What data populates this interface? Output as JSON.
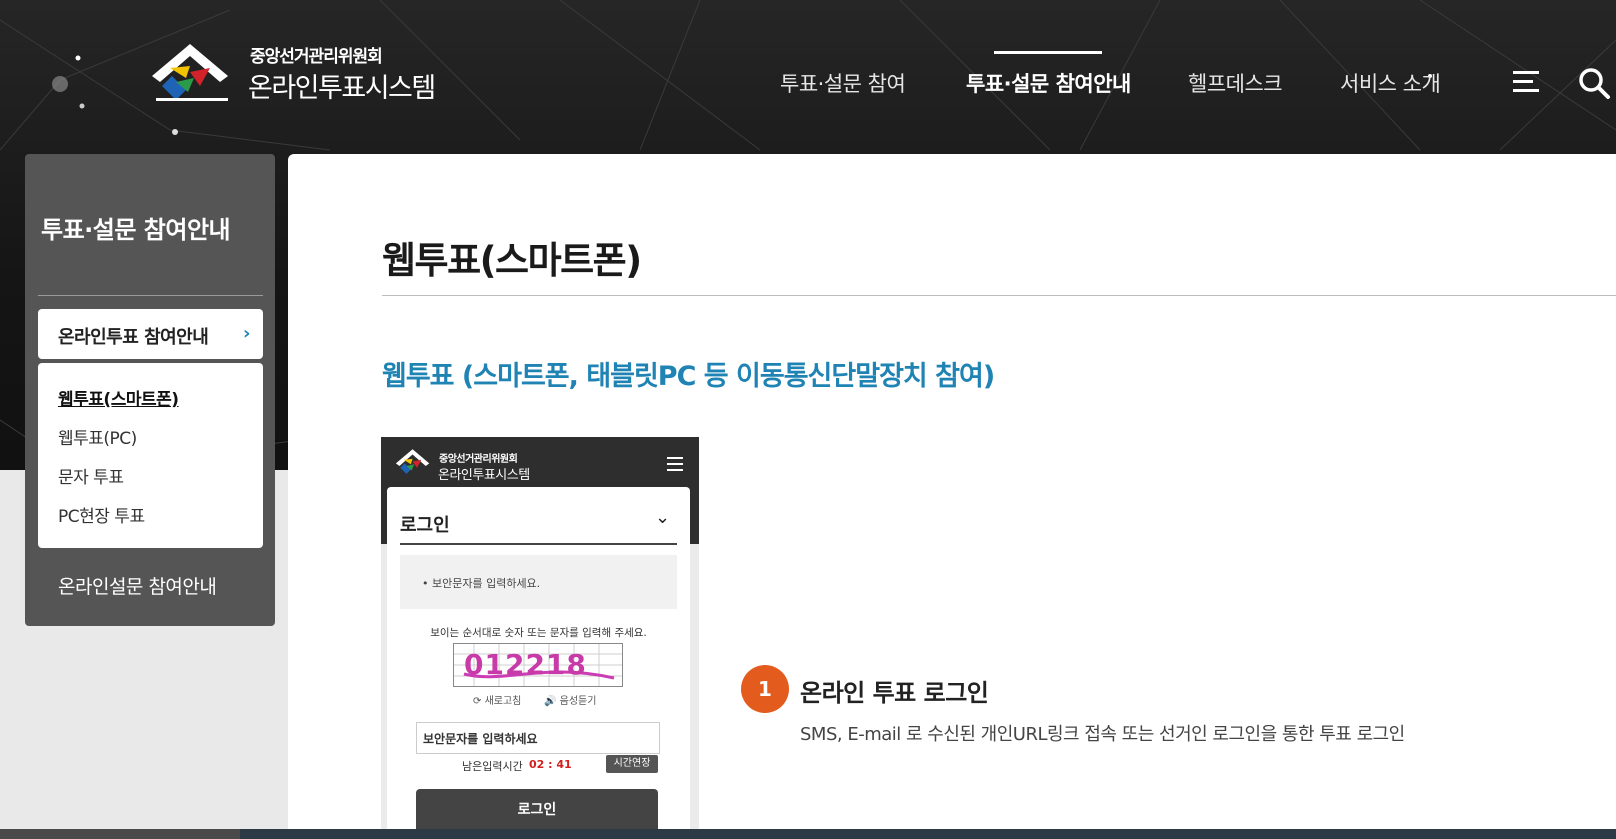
{
  "header": {
    "org_name": "중앙선거관리위원회",
    "system_name": "온라인투표시스템",
    "nav": [
      {
        "label": "투표·설문 참여"
      },
      {
        "label": "투표·설문 참여안내"
      },
      {
        "label": "헬프데스크"
      },
      {
        "label": "서비스 소개"
      }
    ],
    "menu_icon": "hamburger-icon",
    "search_icon": "search-icon"
  },
  "sidebar": {
    "title": "투표·설문 참여안내",
    "active_group": "온라인투표 참여안내",
    "active_group_icon": "chevron-right-icon",
    "sub_items": [
      {
        "label": "웹투표(스마트폰)"
      },
      {
        "label": "웹투표(PC)"
      },
      {
        "label": "문자 투표"
      },
      {
        "label": "PC현장 투표"
      }
    ],
    "other_group": "온라인설문 참여안내"
  },
  "main": {
    "page_title": "웹투표(스마트폰)",
    "section_title": "웹투표 (스마트폰, 태블릿PC 등 이동통신단말장치 참여)",
    "phone": {
      "org_name": "중앙선거관리위원회",
      "system_name": "온라인투표시스템",
      "login_header": "로그인",
      "notice": "• 보안문자를 입력하세요.",
      "instruction": "보이는 순서대로 숫자 또는 문자를 입력해 주세요.",
      "captcha_text": "012218",
      "refresh_label": "새로고침",
      "audio_label": "음성듣기",
      "input_placeholder": "보안문자를 입력하세요",
      "remaining_label": "남은입력시간",
      "remaining_time": "02 : 41",
      "extend_label": "시간연장",
      "login_button": "로그인"
    },
    "step": {
      "number": "1",
      "title": "온라인 투표 로그인",
      "description": "SMS, E-mail 로 수신된 개인URL링크 접속 또는 선거인 로그인을 통한 투표 로그인"
    }
  },
  "colors": {
    "accent_blue": "#1f83b4",
    "step_orange": "#e35b1d",
    "sidebar_bg": "#555555",
    "timer_red": "#d21f1f"
  }
}
